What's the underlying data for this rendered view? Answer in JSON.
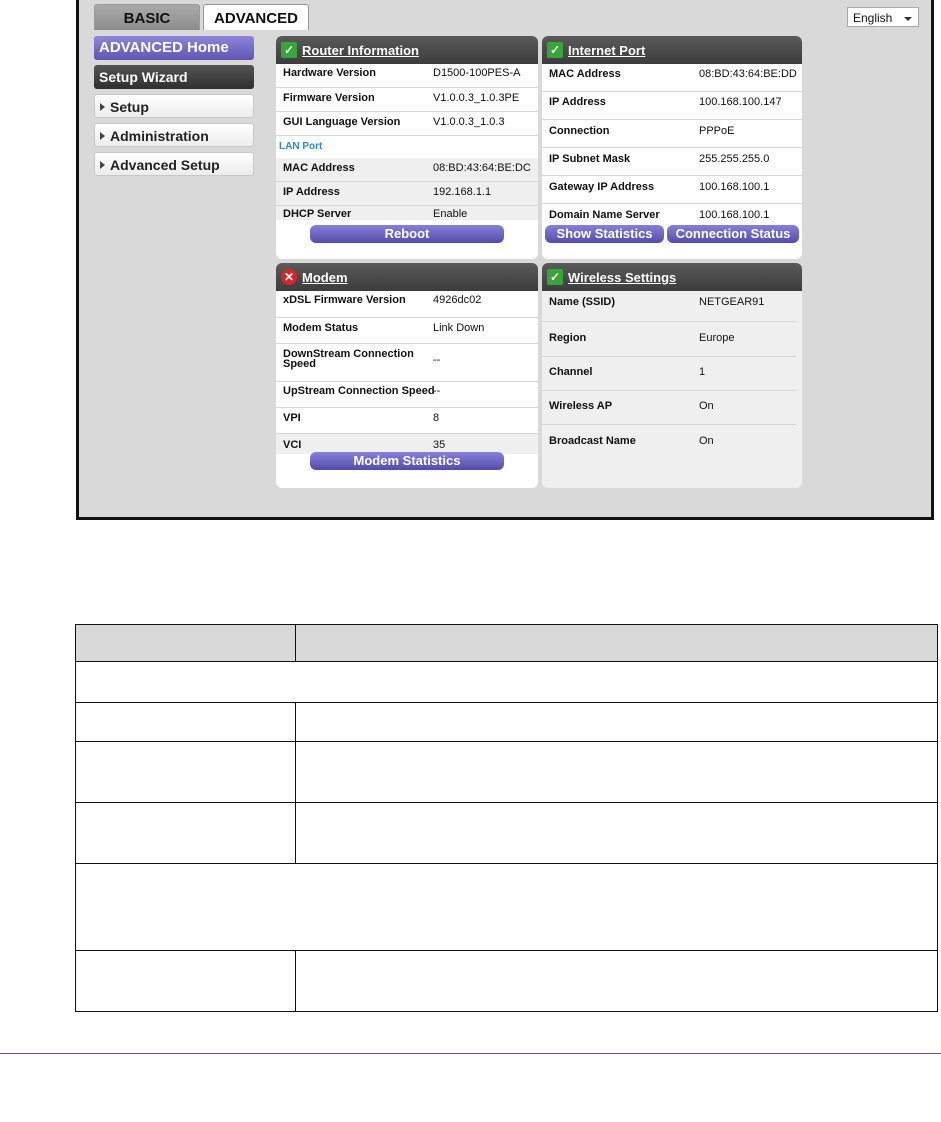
{
  "tabs": {
    "basic": "BASIC",
    "advanced": "ADVANCED"
  },
  "language": "English",
  "nav": {
    "home": "ADVANCED Home",
    "wizard": "Setup Wizard",
    "setup": "Setup",
    "administration": "Administration",
    "advanced_setup": "Advanced Setup"
  },
  "router": {
    "title": "Router Information",
    "rows": [
      {
        "k": "Hardware Version",
        "v": "D1500-100PES-A"
      },
      {
        "k": "Firmware Version",
        "v": "V1.0.0.3_1.0.3PE"
      },
      {
        "k": "GUI Language Version",
        "v": "V1.0.0.3_1.0.3"
      }
    ],
    "lan_label": "LAN Port",
    "lan_rows": [
      {
        "k": "MAC Address",
        "v": "08:BD:43:64:BE:DC"
      },
      {
        "k": "IP Address",
        "v": "192.168.1.1"
      },
      {
        "k": "DHCP Server",
        "v": "Enable"
      }
    ],
    "reboot": "Reboot"
  },
  "internet": {
    "title": "Internet Port",
    "rows": [
      {
        "k": "MAC Address",
        "v": "08:BD:43:64:BE:DD"
      },
      {
        "k": "IP Address",
        "v": "100.168.100.147"
      },
      {
        "k": "Connection",
        "v": "PPPoE"
      },
      {
        "k": "IP Subnet Mask",
        "v": "255.255.255.0"
      },
      {
        "k": "Gateway IP Address",
        "v": "100.168.100.1"
      },
      {
        "k": "Domain Name Server",
        "v": "100.168.100.1"
      }
    ],
    "show_stats": "Show Statistics",
    "conn_status": "Connection Status"
  },
  "modem": {
    "title": "Modem",
    "rows": [
      {
        "k": "xDSL Firmware Version",
        "v": "4926dc02"
      },
      {
        "k": "Modem Status",
        "v": "Link Down"
      },
      {
        "k": "DownStream Connection Speed",
        "v": "--"
      },
      {
        "k": "UpStream Connection Speed",
        "v": "--"
      },
      {
        "k": "VPI",
        "v": "8"
      },
      {
        "k": "VCI",
        "v": "35"
      }
    ],
    "stats_btn": "Modem Statistics"
  },
  "wireless": {
    "title": "Wireless Settings",
    "rows": [
      {
        "k": "Name (SSID)",
        "v": "NETGEAR91"
      },
      {
        "k": "Region",
        "v": "Europe"
      },
      {
        "k": "Channel",
        "v": "1"
      },
      {
        "k": "Wireless AP",
        "v": "On"
      },
      {
        "k": "Broadcast Name",
        "v": "On"
      }
    ]
  }
}
